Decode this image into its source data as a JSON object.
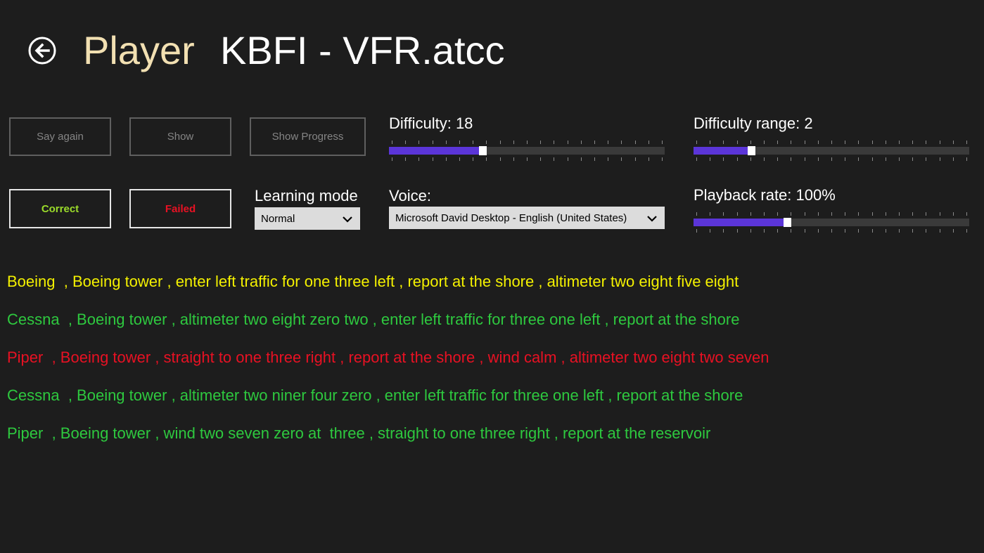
{
  "header": {
    "title": "Player",
    "file_name": "KBFI - VFR.atcc",
    "back_icon": "back-arrow-icon"
  },
  "buttons": {
    "say_again": "Say again",
    "show": "Show",
    "show_progress": "Show Progress",
    "correct": "Correct",
    "failed": "Failed"
  },
  "learning_mode": {
    "label": "Learning mode",
    "selected": "Normal"
  },
  "voice": {
    "label": "Voice:",
    "selected": "Microsoft David Desktop - English (United States)"
  },
  "sliders": {
    "difficulty": {
      "label": "Difficulty: 18",
      "fraction": 0.34,
      "ticks": 21
    },
    "difficulty_range": {
      "label": "Difficulty range: 2",
      "fraction": 0.21,
      "ticks": 21
    },
    "playback_rate": {
      "label": "Playback rate: 100%",
      "fraction": 0.34,
      "ticks": 21
    }
  },
  "colors": {
    "background": "#1d1d1d",
    "title": "#f2e0b2",
    "slider_fill": "#5b35d8",
    "correct": "#9bdc2a",
    "failed": "#e81123",
    "line_current": "#f4f100",
    "line_correct": "#2ec93f",
    "line_failed": "#e81123"
  },
  "transcript": [
    {
      "text": "Boeing  , Boeing tower , enter left traffic for one three left , report at the shore , altimeter two eight five eight",
      "status": "current"
    },
    {
      "text": "Cessna  , Boeing tower , altimeter two eight zero two , enter left traffic for three one left , report at the shore",
      "status": "correct"
    },
    {
      "text": "Piper  , Boeing tower , straight to one three right , report at the shore , wind calm , altimeter two eight two seven",
      "status": "failed"
    },
    {
      "text": "Cessna  , Boeing tower , altimeter two niner four zero , enter left traffic for three one left , report at the shore",
      "status": "correct"
    },
    {
      "text": "Piper  , Boeing tower , wind two seven zero at  three , straight to one three right , report at the reservoir",
      "status": "correct"
    }
  ]
}
